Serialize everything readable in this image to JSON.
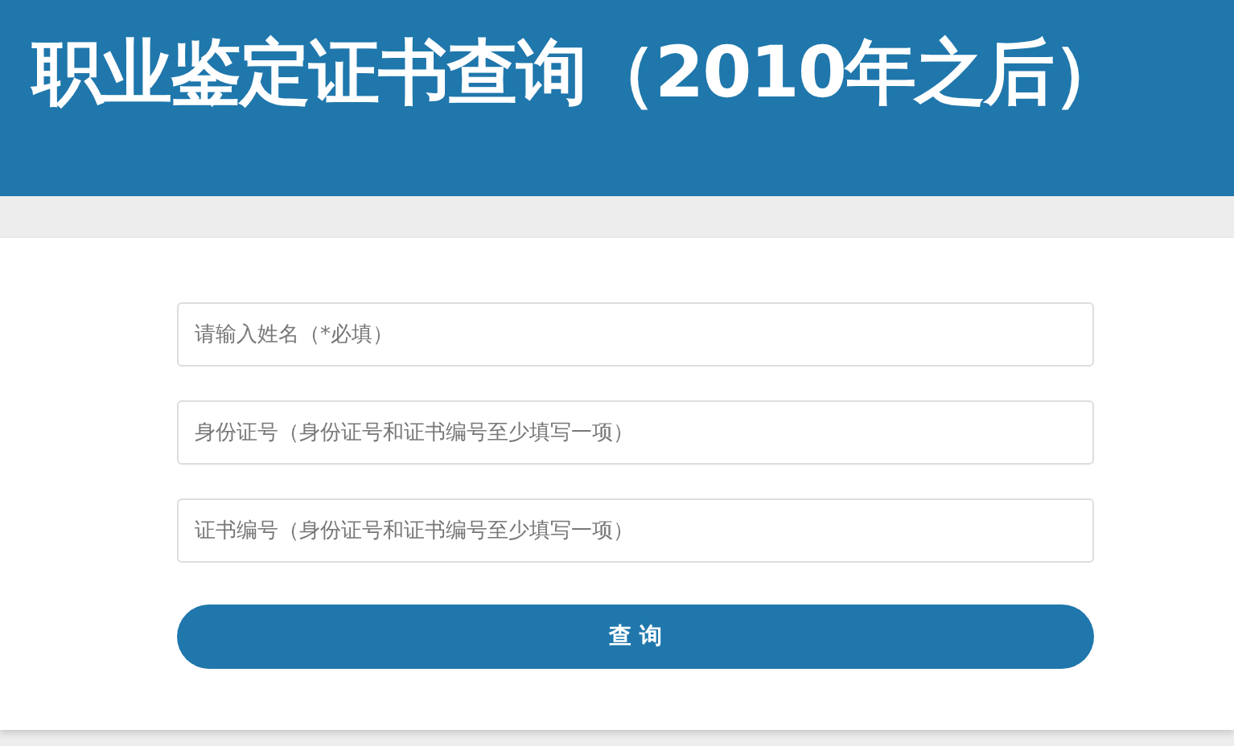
{
  "header": {
    "title": "职业鉴定证书查询（2010年之后）"
  },
  "form": {
    "fields": [
      {
        "placeholder": "请输入姓名（*必填）"
      },
      {
        "placeholder": "身份证号（身份证号和证书编号至少填写一项）"
      },
      {
        "placeholder": "证书编号（身份证号和证书编号至少填写一项）"
      }
    ],
    "submit": "查 询"
  }
}
